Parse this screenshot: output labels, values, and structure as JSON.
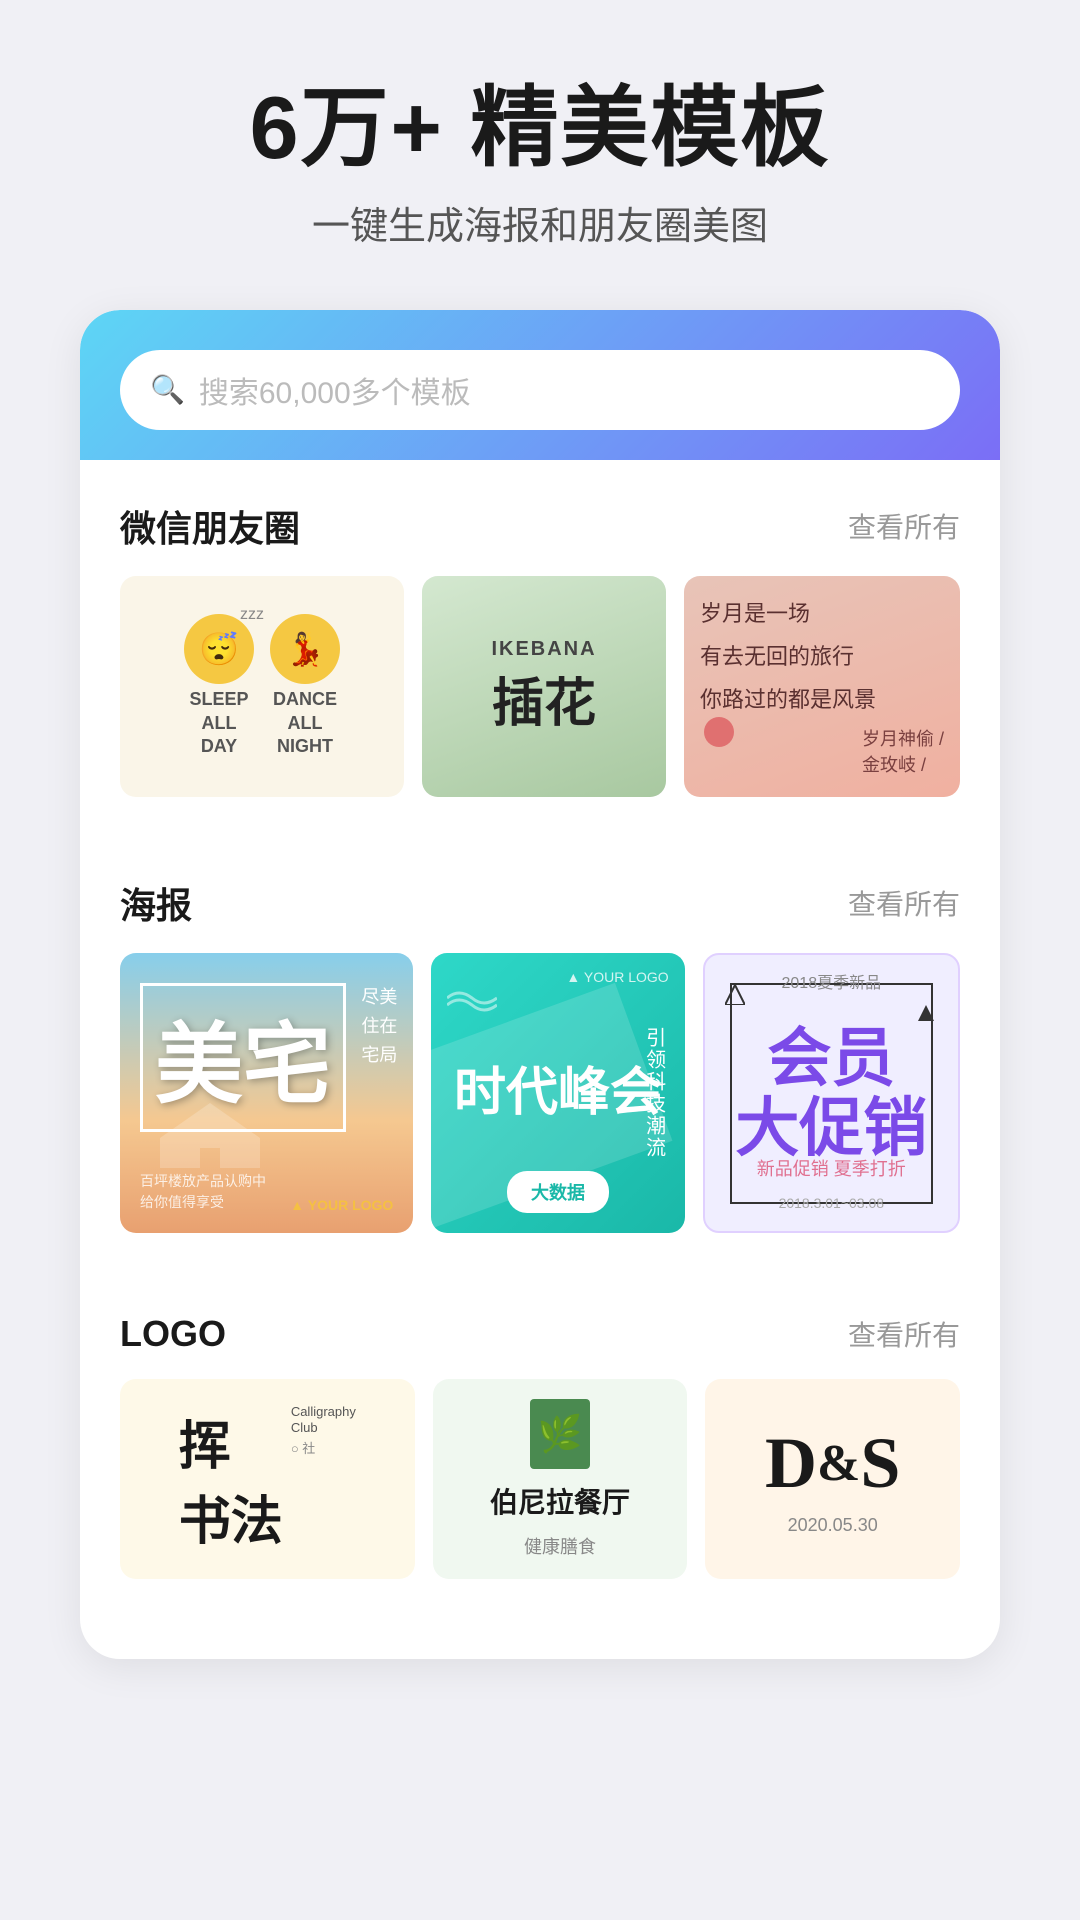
{
  "hero": {
    "title": "6万+ 精美模板",
    "subtitle": "一键生成海报和朋友圈美图"
  },
  "search": {
    "placeholder": "搜索60,000多个模板"
  },
  "sections": {
    "wechat": {
      "title": "微信朋友圈",
      "view_all": "查看所有"
    },
    "poster": {
      "title": "海报",
      "view_all": "查看所有"
    },
    "logo": {
      "title": "LOGO",
      "view_all": "查看所有"
    }
  },
  "wechat_templates": [
    {
      "type": "sleep_dance",
      "label1": "SLEEP ALL DAY",
      "label2": "DANCE ALL NIGHT"
    },
    {
      "type": "ikebana",
      "en_label": "IKEBANA",
      "zh_label": "插花"
    },
    {
      "type": "poem",
      "lines": [
        "岁月是一场",
        "有去无回的旅行",
        "你路过的都是风景"
      ],
      "author": "岁月神偷 /\n金玫岐 /"
    }
  ],
  "poster_templates": [
    {
      "main": "美宅",
      "sub": "尽美\n住在\n宅局",
      "detail": "百坪楼放\n给你值得享受",
      "logo": "▲ YOUR LOGO"
    },
    {
      "side": "引领科技潮流",
      "main": "时代峰会",
      "sub": "大数据",
      "top": "▲ YOUR LOGO",
      "btn": "大数据"
    },
    {
      "year": "2018夏季新品",
      "main": "会员\n大促销",
      "sub": "新品促销 夏季打折",
      "dates": "2018.3.01~03.08"
    }
  ],
  "logo_templates": [
    {
      "brush_char": "挥",
      "main_char": "书法",
      "en_name": "Calligraphy",
      "en_sub": "Club",
      "zh_sub": "社"
    },
    {
      "name": "伯尼拉餐厅",
      "sub": "健康膳食"
    },
    {
      "letters": "D&S",
      "date": "2020.05.30"
    }
  ]
}
